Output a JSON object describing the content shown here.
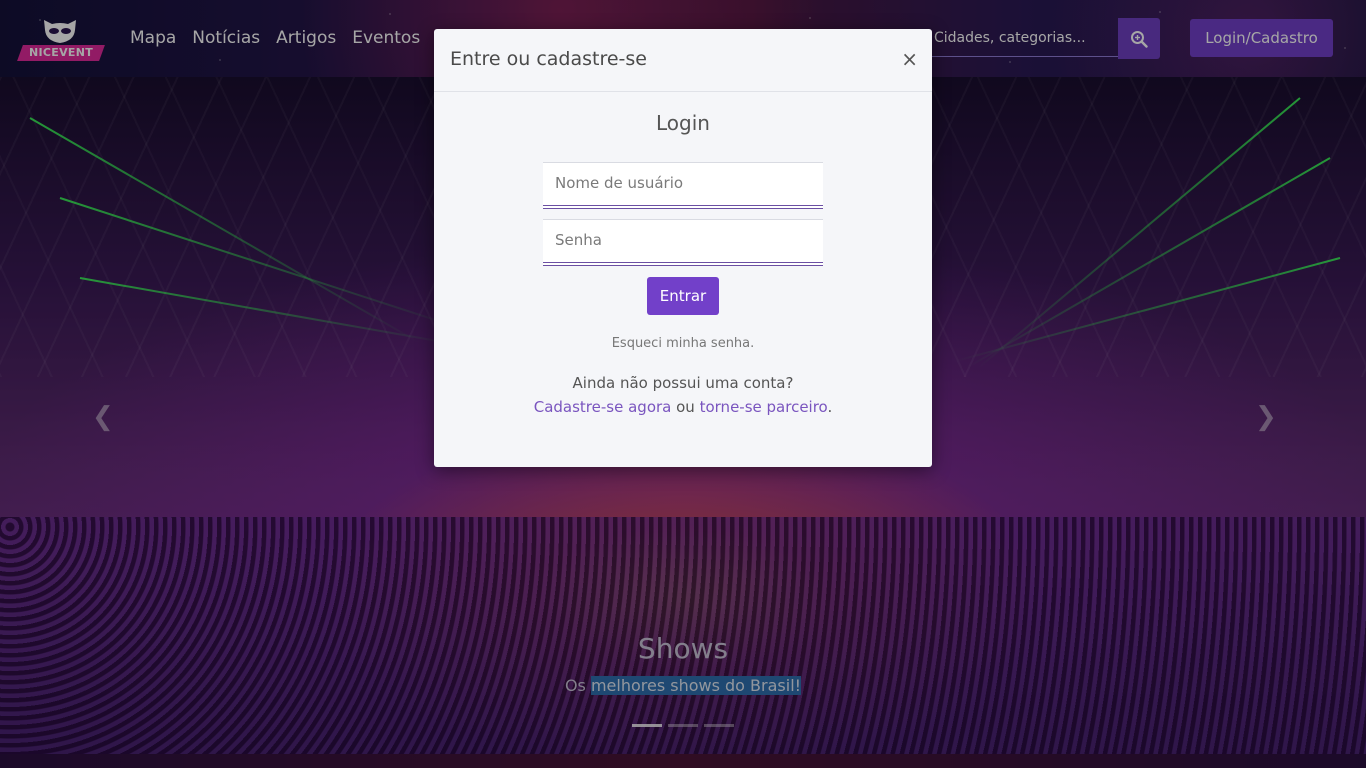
{
  "brand": {
    "name": "NICEVENT"
  },
  "nav": {
    "links": [
      "Mapa",
      "Notícias",
      "Artigos",
      "Eventos"
    ]
  },
  "search": {
    "placeholder": "Cidades, categorias...",
    "value": "",
    "button_icon": "search-zoom-icon"
  },
  "header": {
    "login_label": "Login/Cadastro"
  },
  "carousel": {
    "title": "Shows",
    "subtitle_prefix": "Os ",
    "subtitle_highlight": "melhores shows do Brasil!",
    "prev_icon": "chevron-left-icon",
    "next_icon": "chevron-right-icon",
    "slides_count": 3,
    "active_slide": 1
  },
  "modal": {
    "title": "Entre ou cadastre-se",
    "close_symbol": "×",
    "heading": "Login",
    "username_placeholder": "Nome de usuário",
    "password_placeholder": "Senha",
    "submit_label": "Entrar",
    "forgot_label": "Esqueci minha senha.",
    "no_account_text": "Ainda não possui uma conta?",
    "register_link": "Cadastre-se agora",
    "or_text": " ou ",
    "partner_link": "torne-se parceiro",
    "period": "."
  },
  "colors": {
    "accent": "#7240c9",
    "link": "#7a55bf",
    "logo_pink": "#e02a9c"
  }
}
